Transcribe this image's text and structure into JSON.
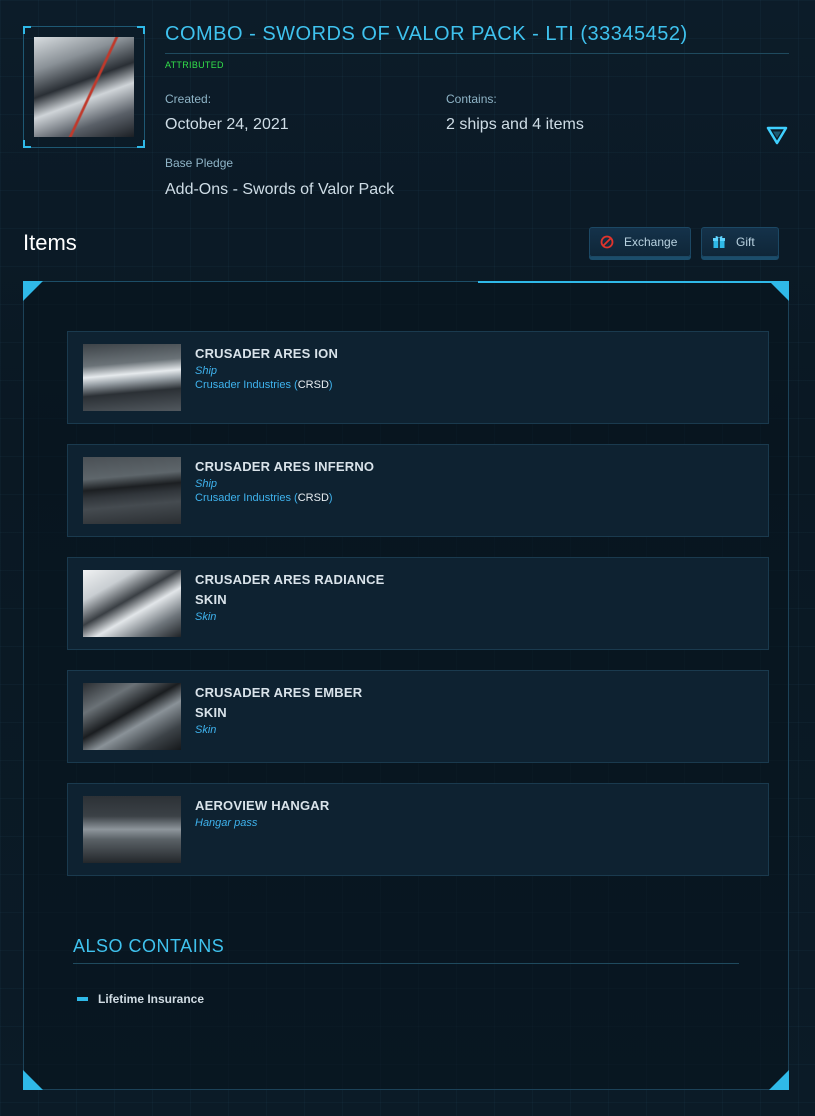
{
  "pledge": {
    "title": "COMBO - SWORDS OF VALOR PACK - LTI (33345452)",
    "status": "ATTRIBUTED",
    "created_label": "Created:",
    "created_value": "October 24, 2021",
    "contains_label": "Contains:",
    "contains_value": "2 ships and 4 items",
    "base_label": "Base Pledge",
    "base_value": "Add-Ons - Swords of Valor Pack"
  },
  "items_section": {
    "heading": "Items",
    "exchange_label": "Exchange",
    "gift_label": "Gift"
  },
  "items": [
    {
      "name": "CRUSADER ARES ION",
      "type": "Ship",
      "manufacturer": "Crusader Industries (",
      "code": "CRSD",
      "close": ")"
    },
    {
      "name": "CRUSADER ARES INFERNO",
      "type": "Ship",
      "manufacturer": "Crusader Industries (",
      "code": "CRSD",
      "close": ")"
    },
    {
      "name": "CRUSADER ARES RADIANCE SKIN",
      "type": "Skin"
    },
    {
      "name": "CRUSADER ARES EMBER SKIN",
      "type": "Skin"
    },
    {
      "name": "AEROVIEW HANGAR",
      "type": "Hangar pass"
    }
  ],
  "also_contains": {
    "title": "ALSO CONTAINS",
    "items": [
      "Lifetime Insurance"
    ]
  },
  "colors": {
    "accent": "#2fb9e8",
    "title_blue": "#3fc2ee",
    "attributed_green": "#33e04a",
    "exchange_icon_red": "#e0342c",
    "background": "#0b1a26"
  },
  "icons": {
    "exchange": "no-entry-icon",
    "gift": "gift-box-icon",
    "expand": "triangle-down-icon"
  }
}
